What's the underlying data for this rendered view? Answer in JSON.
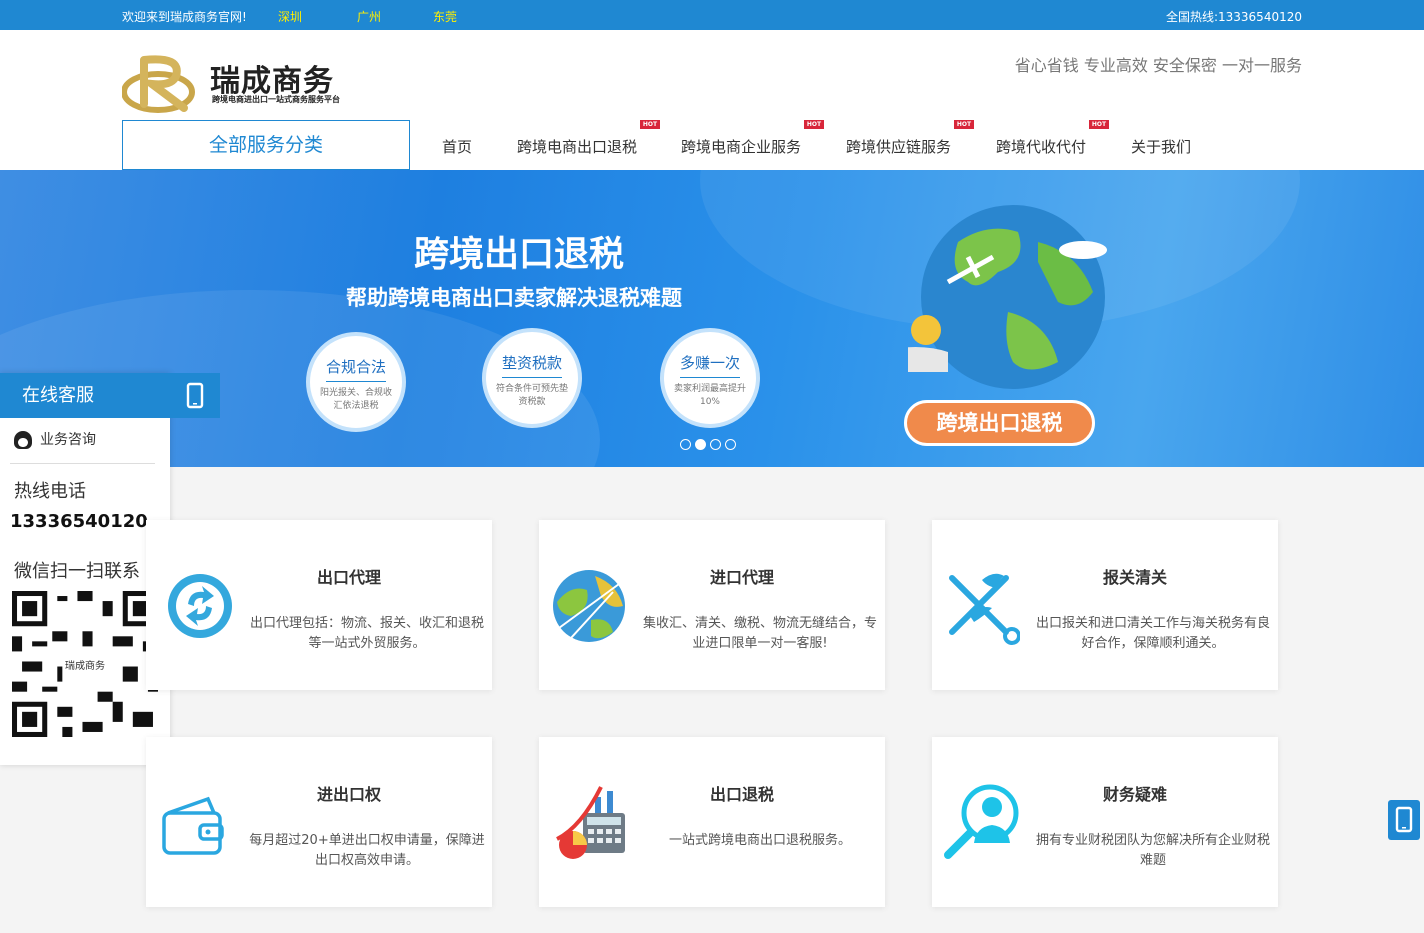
{
  "topbar": {
    "welcome": "欢迎来到瑞成商务官网!",
    "cities": [
      "深圳 ",
      "广州",
      "东莞 "
    ],
    "hotline": " 全国热线:13336540120"
  },
  "header": {
    "logo_name": "瑞成商务",
    "logo_tagline": "跨境电商进出口一站式商务服务平台",
    "slogan": " 省心省钱  专业高效  安全保密  一对一服务",
    "all_services": "全部服务分类",
    "nav": [
      "首页",
      "跨境电商出口退税",
      "跨境电商企业服务",
      "跨境供应链服务",
      "跨境代收代付",
      "关于我们"
    ],
    "hot_label": "HOT"
  },
  "banner": {
    "title": "跨境出口退税",
    "subtitle": "帮助跨境电商出口卖家解决退税难题",
    "features": [
      {
        "title": "合规合法",
        "desc": "阳光报关、合规收汇依法退税"
      },
      {
        "title": "垫资税款",
        "desc": "符合条件可预先垫资税款"
      },
      {
        "title": "多赚一次",
        "desc": "卖家利润最高提升10%"
      }
    ],
    "button": "跨境出口退税",
    "slides": 4,
    "active_slide": 2
  },
  "service_panel": {
    "header": "在线客服",
    "qq_label": "业务咨询",
    "hotline_label": "热线电话",
    "hotline_number": "13336540120",
    "wechat_label": "微信扫一扫联系",
    "qr_caption": "瑞成商务"
  },
  "cards": [
    {
      "title": "出口代理",
      "desc": "出口代理包括：物流、报关、收汇和退税等一站式外贸服务。",
      "icon": "refresh-circle-icon"
    },
    {
      "title": "进口代理",
      "desc": "集收汇、清关、缴税、物流无缝结合，专业进口限单一对一客服!",
      "icon": "globe-icon"
    },
    {
      "title": "报关清关",
      "desc": "出口报关和进口清关工作与海关税务有良好合作，保障顺利通关。",
      "icon": "customs-emblem-icon"
    },
    {
      "title": "进出口权",
      "desc": "每月超过20+单进出口权申请量，保障进出口权高效申请。",
      "icon": "wallet-icon"
    },
    {
      "title": "出口退税",
      "desc": "一站式跨境电商出口退税服务。",
      "icon": "calculator-chart-icon"
    },
    {
      "title": "财务疑难",
      "desc": "拥有专业财税团队为您解决所有企业财税难题",
      "icon": "magnifier-person-icon"
    }
  ],
  "colors": {
    "primary": "#1f88d2",
    "accent": "#f08a4b",
    "hot": "#d8263a"
  }
}
